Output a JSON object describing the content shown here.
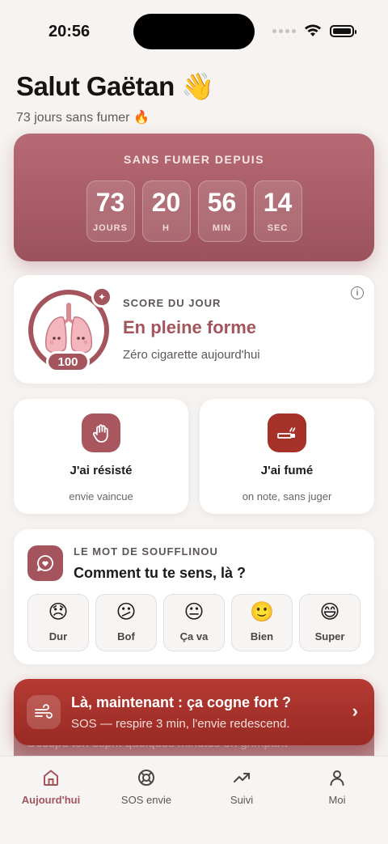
{
  "status_bar": {
    "time": "20:56"
  },
  "header": {
    "greeting": "Salut Gaëtan 👋",
    "subtitle": "73 jours sans fumer 🔥"
  },
  "timer": {
    "title": "SANS FUMER DEPUIS",
    "units": [
      {
        "value": "73",
        "label": "JOURS"
      },
      {
        "value": "20",
        "label": "H"
      },
      {
        "value": "56",
        "label": "MIN"
      },
      {
        "value": "14",
        "label": "SEC"
      }
    ]
  },
  "score": {
    "eyebrow": "SCORE DU JOUR",
    "title": "En pleine forme",
    "subtitle": "Zéro cigarette aujourd'hui",
    "value": "100",
    "info_icon": "i"
  },
  "actions": {
    "resisted": {
      "title": "J'ai résisté",
      "subtitle": "envie vaincue",
      "icon": "hand-icon"
    },
    "smoked": {
      "title": "J'ai fumé",
      "subtitle": "on note, sans juger",
      "icon": "cigarette-icon"
    }
  },
  "mood": {
    "eyebrow": "LE MOT DE SOUFFLINOU",
    "question": "Comment tu te sens, là ?",
    "options": [
      {
        "emoji": "😞",
        "label": "Dur"
      },
      {
        "emoji": "😕",
        "label": "Bof"
      },
      {
        "emoji": "😐",
        "label": "Ça va"
      },
      {
        "emoji": "🙂",
        "label": "Bien"
      },
      {
        "emoji": "😄",
        "label": "Super"
      }
    ]
  },
  "peek_text": "Occupe ton esprit quelques minutes en grimpant",
  "sos": {
    "title": "Là, maintenant : ça cogne fort ?",
    "subtitle": "SOS — respire 3 min, l'envie redescend.",
    "chevron": "›"
  },
  "tabbar": {
    "items": [
      {
        "label": "Aujourd'hui",
        "icon": "home-icon",
        "active": true
      },
      {
        "label": "SOS envie",
        "icon": "lifebuoy-icon",
        "active": false
      },
      {
        "label": "Suivi",
        "icon": "trend-icon",
        "active": false
      },
      {
        "label": "Moi",
        "icon": "person-icon",
        "active": false
      }
    ]
  },
  "colors": {
    "brand": "#a4545c",
    "sos": "#a63129"
  }
}
